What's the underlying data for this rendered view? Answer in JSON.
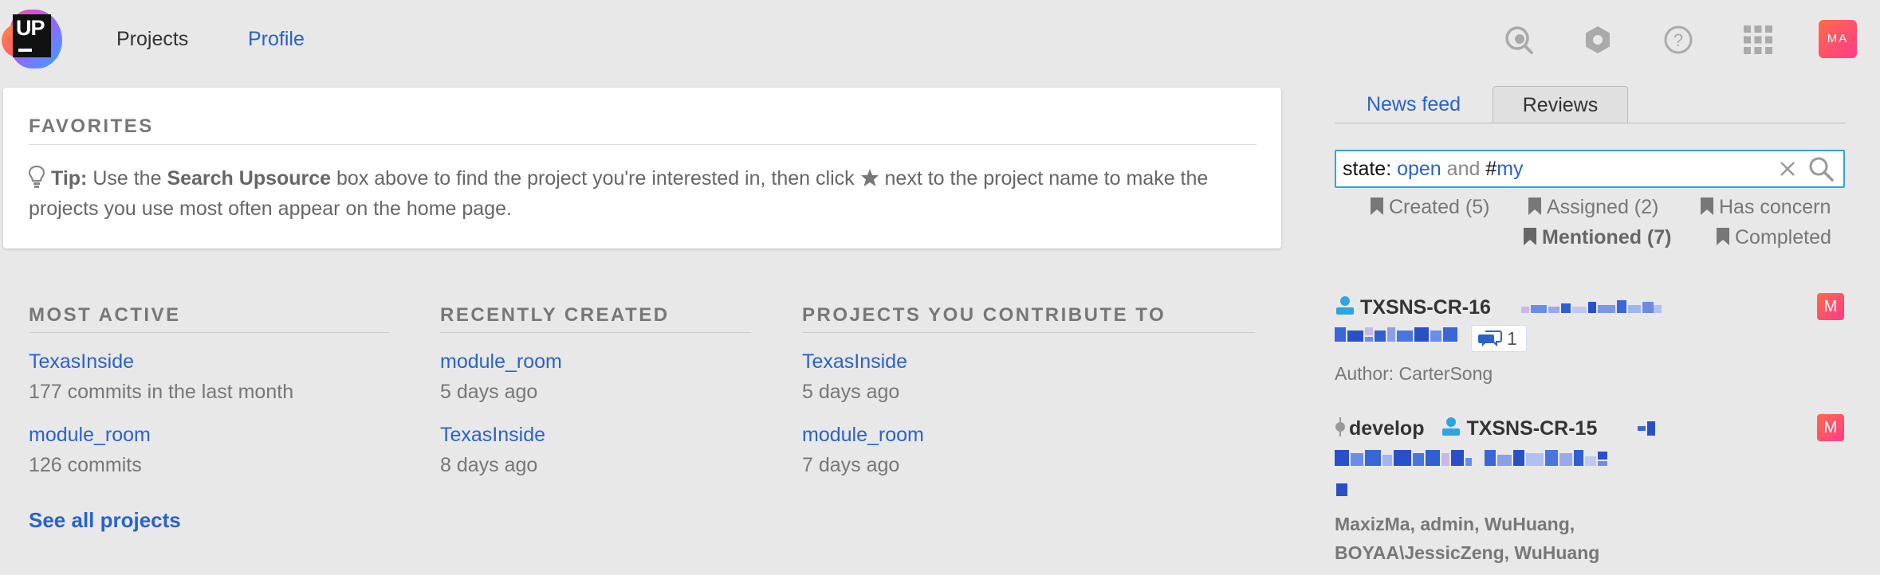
{
  "header": {
    "logo_text": "UP",
    "nav": [
      {
        "label": "Projects"
      },
      {
        "label": "Profile"
      }
    ],
    "icons": [
      "search-icon",
      "settings-hexagon-icon",
      "help-icon",
      "apps-grid-icon"
    ],
    "avatar_initials": "MA"
  },
  "favorites": {
    "title": "FAVORITES",
    "tip_prefix": "Tip:",
    "tip_part1": " Use the ",
    "tip_bold": "Search Upsource",
    "tip_part2": " box above to find the project you're interested in, then click ",
    "tip_part3": " next to the project name to make the projects you use most often appear on the home page."
  },
  "most_active": {
    "title": "MOST ACTIVE",
    "items": [
      {
        "name": "TexasInside",
        "detail": "177 commits in the last month"
      },
      {
        "name": "module_room",
        "detail": "126 commits"
      }
    ],
    "see_all": "See all projects"
  },
  "recently_created": {
    "title": "RECENTLY CREATED",
    "items": [
      {
        "name": "module_room",
        "detail": "5 days ago"
      },
      {
        "name": "TexasInside",
        "detail": "8 days ago"
      }
    ]
  },
  "contribute": {
    "title": "PROJECTS YOU CONTRIBUTE TO",
    "items": [
      {
        "name": "TexasInside",
        "detail": "5 days ago"
      },
      {
        "name": "module_room",
        "detail": "7 days ago"
      }
    ]
  },
  "right_panel": {
    "tabs": [
      {
        "label": "News feed",
        "active": false
      },
      {
        "label": "Reviews",
        "active": true
      }
    ],
    "search": {
      "part_state": "state: ",
      "part_open": "open",
      "part_and": " and ",
      "part_hash": "#",
      "part_my": "my"
    },
    "filters": [
      {
        "label": "Created (5)",
        "active": false
      },
      {
        "label": "Assigned (2)",
        "active": false
      },
      {
        "label": "Has concern",
        "active": false
      },
      {
        "label": "Mentioned (7)",
        "active": true
      },
      {
        "label": "Completed",
        "active": false
      }
    ],
    "reviews": [
      {
        "id": "TXSNS-CR-16",
        "comment_count": "1",
        "author": "Author: CarterSong",
        "avatar": "M"
      },
      {
        "branch": "develop",
        "id": "TXSNS-CR-15",
        "participants_line1": "MaxizMa, admin, WuHuang,",
        "participants_line2": "BOYAA\\JessicZeng, WuHuang",
        "avatar": "M"
      }
    ]
  },
  "colors": {
    "link": "#2a62c9",
    "accent_border": "#2ea4e0",
    "background": "#e8e8e8",
    "avatar_gradient_start": "#ff6a4a",
    "avatar_gradient_end": "#ff3b8a"
  }
}
